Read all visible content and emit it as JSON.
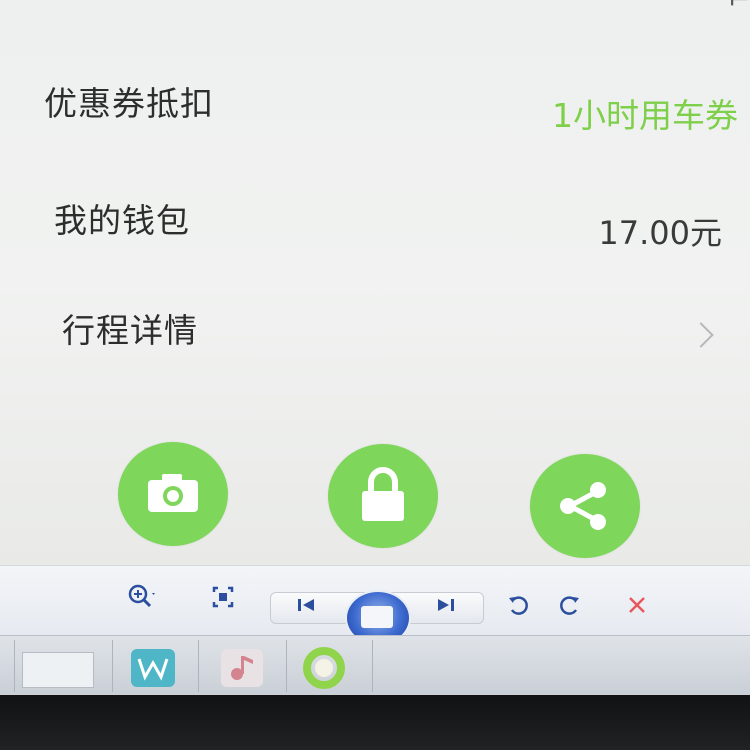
{
  "rows": [
    {
      "label": "优惠券抵扣",
      "value": "1小时用车券"
    },
    {
      "label": "我的钱包",
      "value": "17.00元"
    },
    {
      "label": "行程详情"
    }
  ],
  "colors": {
    "accent_green": "#7ed65b",
    "coupon_text": "#7ecf4a",
    "close_red": "#e8585a",
    "toolbar_blue": "#3d6bd0"
  },
  "actions": [
    {
      "icon": "camera-icon"
    },
    {
      "icon": "lock-icon"
    },
    {
      "icon": "share-icon"
    }
  ],
  "toolbar": {
    "buttons": [
      "zoom-in-icon",
      "fit-screen-icon",
      "previous-icon",
      "slideshow-icon",
      "next-icon",
      "rotate-left-icon",
      "rotate-right-icon",
      "close-icon"
    ]
  },
  "taskbar": {
    "items": [
      "window-thumbnail",
      "w-app-icon",
      "music-app-icon",
      "green-ring-app-icon"
    ]
  }
}
